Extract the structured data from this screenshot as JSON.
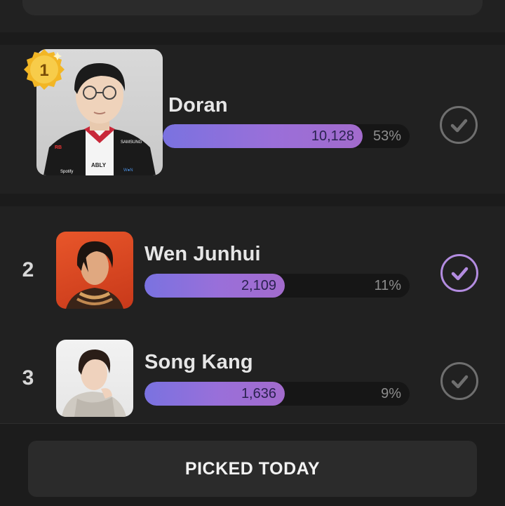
{
  "ranking": [
    {
      "rank": "1",
      "name": "Doran",
      "votes": "10,128",
      "percent": "53%",
      "fraction": 0.53,
      "selected": false,
      "avatar_icon": "person-portrait-esports-jersey"
    },
    {
      "rank": "2",
      "name": "Wen Junhui",
      "votes": "2,109",
      "percent": "11%",
      "fraction": 0.11,
      "selected": true,
      "avatar_icon": "person-portrait-orange-background"
    },
    {
      "rank": "3",
      "name": "Song Kang",
      "votes": "1,636",
      "percent": "9%",
      "fraction": 0.09,
      "selected": false,
      "avatar_icon": "person-portrait-white-background"
    }
  ],
  "first_place_badge": {
    "number": "1",
    "icon": "gold-medal-badge-icon"
  },
  "jersey_text": {
    "sponsor_1": "SAMSUNG",
    "sponsor_2": "ABLY",
    "sponsor_3": "Spotify",
    "sponsor_4": "W●N"
  },
  "bottom": {
    "button_label": "PICKED TODAY"
  },
  "colors": {
    "background": "#212121",
    "bar_gradient_start": "#7a72e0",
    "bar_gradient_end": "#a26bcc",
    "check_selected": "#b38ce0",
    "check_default": "#6f6f6f"
  }
}
